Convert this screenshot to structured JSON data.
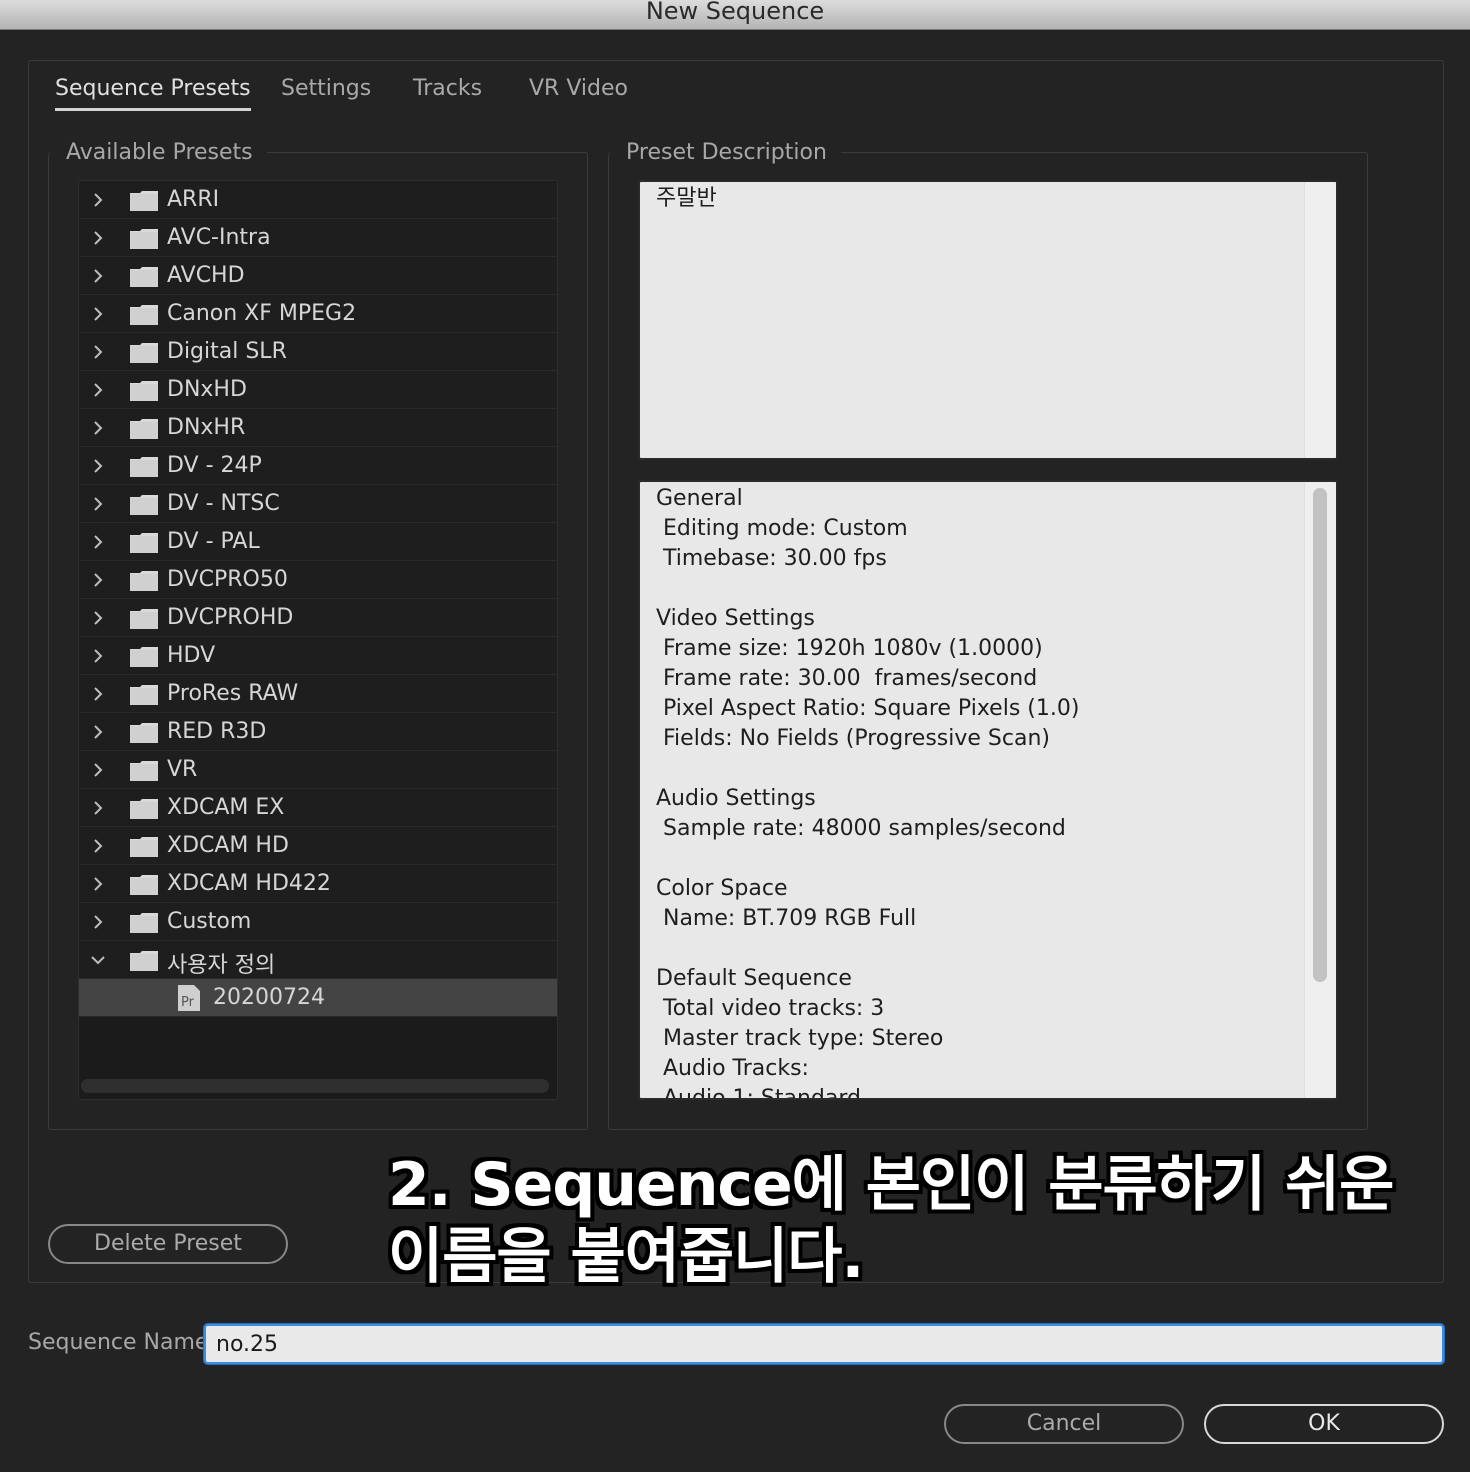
{
  "window": {
    "title": "New Sequence"
  },
  "tabs": [
    {
      "label": "Sequence Presets",
      "active": true
    },
    {
      "label": "Settings",
      "active": false
    },
    {
      "label": "Tracks",
      "active": false
    },
    {
      "label": "VR Video",
      "active": false
    }
  ],
  "presets": {
    "group_label": "Available Presets",
    "items": [
      {
        "label": "ARRI",
        "type": "folder",
        "expanded": false
      },
      {
        "label": "AVC-Intra",
        "type": "folder",
        "expanded": false
      },
      {
        "label": "AVCHD",
        "type": "folder",
        "expanded": false
      },
      {
        "label": "Canon XF MPEG2",
        "type": "folder",
        "expanded": false
      },
      {
        "label": "Digital SLR",
        "type": "folder",
        "expanded": false
      },
      {
        "label": "DNxHD",
        "type": "folder",
        "expanded": false
      },
      {
        "label": "DNxHR",
        "type": "folder",
        "expanded": false
      },
      {
        "label": "DV - 24P",
        "type": "folder",
        "expanded": false
      },
      {
        "label": "DV - NTSC",
        "type": "folder",
        "expanded": false
      },
      {
        "label": "DV - PAL",
        "type": "folder",
        "expanded": false
      },
      {
        "label": "DVCPRO50",
        "type": "folder",
        "expanded": false
      },
      {
        "label": "DVCPROHD",
        "type": "folder",
        "expanded": false
      },
      {
        "label": "HDV",
        "type": "folder",
        "expanded": false
      },
      {
        "label": "ProRes RAW",
        "type": "folder",
        "expanded": false
      },
      {
        "label": "RED R3D",
        "type": "folder",
        "expanded": false
      },
      {
        "label": "VR",
        "type": "folder",
        "expanded": false
      },
      {
        "label": "XDCAM EX",
        "type": "folder",
        "expanded": false
      },
      {
        "label": "XDCAM HD",
        "type": "folder",
        "expanded": false
      },
      {
        "label": "XDCAM HD422",
        "type": "folder",
        "expanded": false
      },
      {
        "label": "Custom",
        "type": "folder",
        "expanded": false
      },
      {
        "label": "사용자 정의",
        "type": "folder",
        "expanded": true
      },
      {
        "label": "20200724",
        "type": "preset",
        "selected": true,
        "icon_text": "Pr"
      }
    ]
  },
  "description": {
    "group_label": "Preset Description",
    "note": "주말반",
    "details": "General\n Editing mode: Custom\n Timebase: 30.00 fps\n\nVideo Settings\n Frame size: 1920h 1080v (1.0000)\n Frame rate: 30.00  frames/second\n Pixel Aspect Ratio: Square Pixels (1.0)\n Fields: No Fields (Progressive Scan)\n\nAudio Settings\n Sample rate: 48000 samples/second\n\nColor Space\n Name: BT.709 RGB Full\n\nDefault Sequence\n Total video tracks: 3\n Master track type: Stereo\n Audio Tracks:\n Audio 1: Standard"
  },
  "buttons": {
    "delete_preset": "Delete Preset",
    "cancel": "Cancel",
    "ok": "OK"
  },
  "sequence_name": {
    "label": "Sequence Name:",
    "value": "no.25"
  },
  "caption": {
    "line1": "2. Sequence에 본인이 분류하기 쉬운",
    "line2": "이름을 붙여줍니다."
  },
  "colors": {
    "background": "#232323",
    "focus_ring": "#3a8ee6",
    "selected_row": "#444444"
  }
}
